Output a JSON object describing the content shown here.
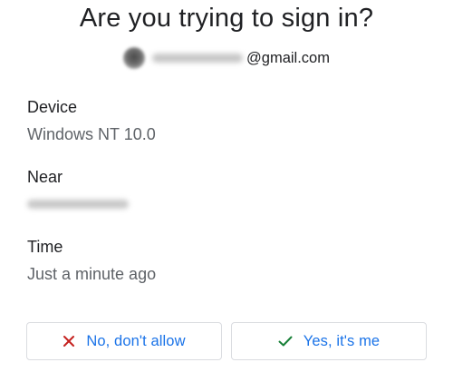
{
  "header": {
    "title": "Are you trying to sign in?",
    "account_domain": "@gmail.com"
  },
  "details": {
    "device_label": "Device",
    "device_value": "Windows NT 10.0",
    "near_label": "Near",
    "time_label": "Time",
    "time_value": "Just a minute ago"
  },
  "actions": {
    "deny_label": "No, don't allow",
    "deny_icon": "close-icon",
    "deny_icon_color": "#c5221f",
    "allow_label": "Yes, it's me",
    "allow_icon": "check-icon",
    "allow_icon_color": "#188038",
    "label_color": "#1a73e8"
  }
}
